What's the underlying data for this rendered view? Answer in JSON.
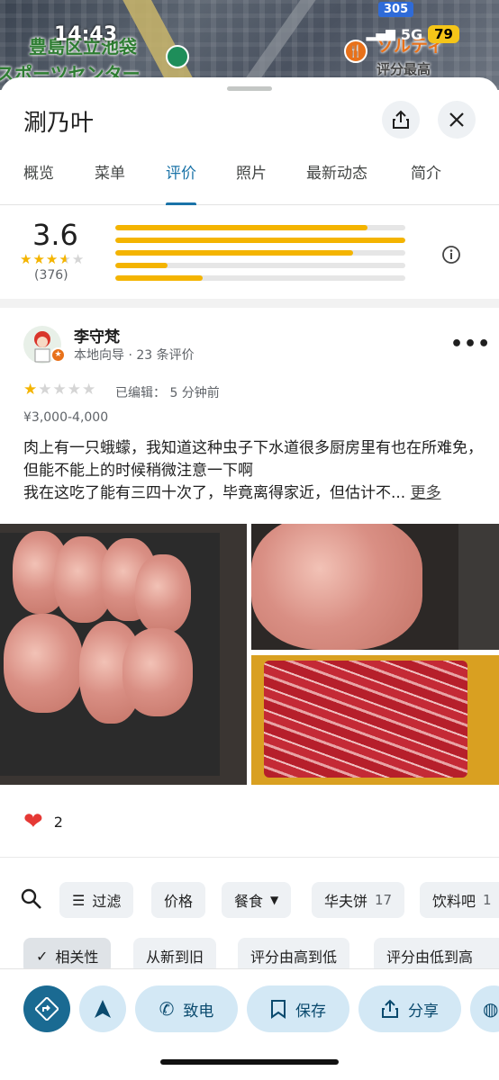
{
  "status": {
    "time": "14:43",
    "battery": "79",
    "network": "5G"
  },
  "map": {
    "label_district": "豊島区立池袋",
    "label_sports": "スポーツセンター",
    "label_restaurant": "ソルティ",
    "label_top_rated": "评分最高",
    "route_number": "305"
  },
  "place": {
    "title": "涮乃叶"
  },
  "tabs": [
    {
      "label": "概览"
    },
    {
      "label": "菜单"
    },
    {
      "label": "评价"
    },
    {
      "label": "照片"
    },
    {
      "label": "最新动态"
    },
    {
      "label": "简介"
    }
  ],
  "rating": {
    "score": "3.6",
    "stars_value": 3.6,
    "count": "(376)",
    "distribution": [
      {
        "stars": 5,
        "fraction": 0.87
      },
      {
        "stars": 4,
        "fraction": 1.0
      },
      {
        "stars": 3,
        "fraction": 0.82
      },
      {
        "stars": 2,
        "fraction": 0.18
      },
      {
        "stars": 1,
        "fraction": 0.3
      }
    ]
  },
  "review": {
    "author": "李守梵",
    "meta": "本地向导 · 23 条评价",
    "stars_value": 1,
    "edited": "已编辑： 5 分钟前",
    "price": "¥3,000-4,000",
    "text_line1": "肉上有一只蛾蠓，我知道这种虫子下水道很多厨房里有也在所难免，但能不能上的时候稍微注意一下啊",
    "text_line2": "我在这吃了能有三四十次了，毕竟离得家近，但估计不...",
    "more_label": "更多",
    "likes": "2"
  },
  "filters": {
    "row1": [
      {
        "label": "过滤",
        "icon": "filter-icon"
      },
      {
        "label": "价格"
      },
      {
        "label": "餐食",
        "icon": "dropdown-icon"
      },
      {
        "label": "华夫饼",
        "count": "17"
      },
      {
        "label": "饮料吧",
        "count": "1"
      }
    ],
    "row2": [
      {
        "label": "相关性",
        "selected": true
      },
      {
        "label": "从新到旧"
      },
      {
        "label": "评分由高到低"
      },
      {
        "label": "评分由低到高"
      }
    ]
  },
  "actions": {
    "call": "致电",
    "save": "保存",
    "share": "分享"
  },
  "colors": {
    "accent": "#1a73a8",
    "star": "#f4b400",
    "action_bg": "#d3e8f5"
  }
}
